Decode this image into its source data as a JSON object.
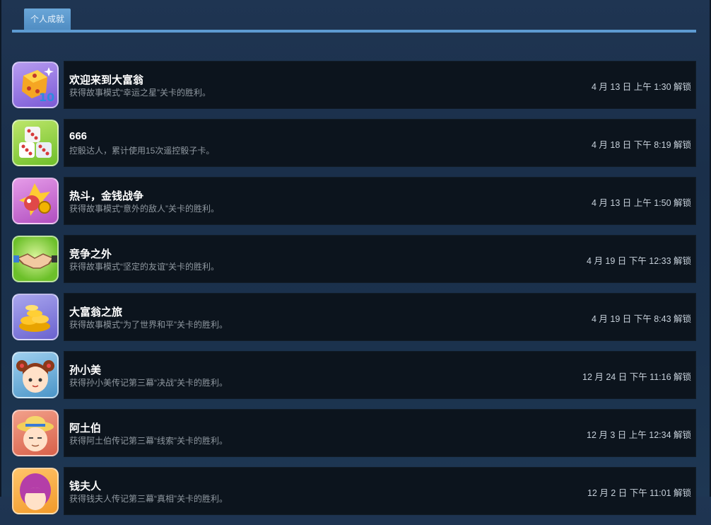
{
  "tab": {
    "label": "个人成就"
  },
  "colors": {
    "accent": "#5d9bd1",
    "row_bg": "#0c141d",
    "title": "#ffffff",
    "desc": "#8f98a0",
    "unlock": "#c6d0da"
  },
  "achievements": [
    {
      "icon": "dice-10-icon",
      "title": "欢迎来到大富翁",
      "desc": "获得故事模式“幸运之星”关卡的胜利。",
      "unlock": "4 月 13 日 上午 1:30 解锁"
    },
    {
      "icon": "dice-pair-icon",
      "title": "666",
      "desc": "控骰达人，累计使用15次遥控骰子卡。",
      "unlock": "4 月 18 日 下午 8:19 解锁"
    },
    {
      "icon": "fighting-coin-icon",
      "title": "热斗，金钱战争",
      "desc": "获得故事模式“意外的敌人”关卡的胜利。",
      "unlock": "4 月 13 日 上午 1:50 解锁"
    },
    {
      "icon": "handshake-icon",
      "title": "竞争之外",
      "desc": "获得故事模式“坚定的友谊”关卡的胜利。",
      "unlock": "4 月 19 日 下午 12:33 解锁"
    },
    {
      "icon": "gold-coins-icon",
      "title": "大富翁之旅",
      "desc": "获得故事模式“为了世界和平”关卡的胜利。",
      "unlock": "4 月 19 日 下午 8:43 解锁"
    },
    {
      "icon": "girl-avatar-icon",
      "title": "孙小美",
      "desc": "获得孙小美传记第三幕“决战”关卡的胜利。",
      "unlock": "12 月 24 日 下午 11:16 解锁"
    },
    {
      "icon": "old-man-avatar-icon",
      "title": "阿土伯",
      "desc": "获得阿土伯传记第三幕“线索”关卡的胜利。",
      "unlock": "12 月 3 日 上午 12:34 解锁"
    },
    {
      "icon": "lady-avatar-icon",
      "title": "钱夫人",
      "desc": "获得钱夫人传记第三幕“真相”关卡的胜利。",
      "unlock": "12 月 2 日 下午 11:01 解锁"
    }
  ]
}
